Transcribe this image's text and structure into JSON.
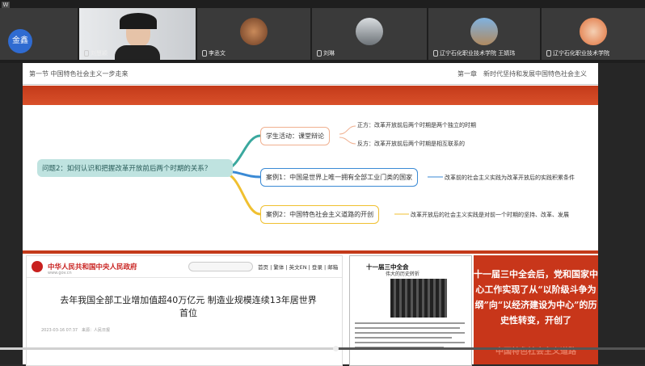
{
  "window": {
    "icon_label": "W"
  },
  "participants": [
    {
      "name": "",
      "avatar_text": "金鑫",
      "type": "text-avatar"
    },
    {
      "name": "刘慧颖",
      "type": "video"
    },
    {
      "name": "李丞文",
      "type": "photo"
    },
    {
      "name": "刘琳",
      "type": "photo"
    },
    {
      "name": "辽宁石化职业技术学院 王婧玮",
      "type": "photo"
    },
    {
      "name": "辽宁石化职业技术学院",
      "type": "photo"
    }
  ],
  "slide": {
    "header_left": "第一节 中国特色社会主义一步走来",
    "header_right": "第一章　新时代坚持和发展中国特色社会主义",
    "root": "问题2：如何认识和把握改革开放前后两个时期的关系？",
    "branches": [
      {
        "label": "学生活动：课堂辩论",
        "leaves": [
          "正方：改革开放前后两个时期是两个独立的时期",
          "反方：改革开放前后两个时期是相互联系的"
        ]
      },
      {
        "label": "案例1：中国是世界上唯一拥有全部工业门类的国家",
        "leaves": [
          "改革前的社会主义实践为改革开放后的实践积累条件"
        ]
      },
      {
        "label": "案例2：中国特色社会主义道路的开创",
        "leaves": [
          "改革开放后的社会主义实践是对前一个时期的坚持、改革、发展"
        ]
      }
    ],
    "gov_site": {
      "title": "中华人民共和国中央人民政府",
      "url": "www.gov.cn",
      "nav": "首页 | 繁体 | 英文EN | 登录 | 邮箱",
      "headline": "去年我国全部工业增加值超40万亿元 制造业规模连续13年居世界首位",
      "meta": "2023-03-16 07:37　来源：人民日报"
    },
    "newspaper": {
      "title": "十一届三中全会",
      "subtitle": "伟大的历史转折"
    },
    "red_panel": {
      "text": "十一届三中全会后，党和国家中心工作实现了从“以阶级斗争为纲”向“以经济建设为中心”的历史性转变，开创了",
      "footer": "中国特色社会主义道路"
    }
  },
  "playback": {
    "progress": 0.52
  },
  "colors": {
    "accent_red": "#c33a1a",
    "avatar_blue": "#2f6bd1"
  }
}
